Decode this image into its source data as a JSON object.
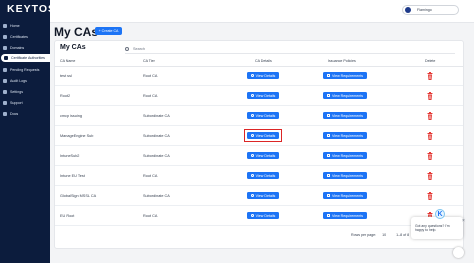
{
  "brand": {
    "logo_text": "KEYTOS"
  },
  "sidebar": {
    "items": [
      {
        "label": "Home",
        "icon": "home-icon"
      },
      {
        "label": "Certificates",
        "icon": "certificate-icon"
      },
      {
        "label": "Domains",
        "icon": "globe-icon"
      },
      {
        "label": "Certificate Authorities",
        "icon": "shield-icon"
      },
      {
        "label": "Pending Requests",
        "icon": "clock-icon"
      },
      {
        "label": "Audit Logs",
        "icon": "list-icon"
      },
      {
        "label": "Settings",
        "icon": "gear-icon"
      },
      {
        "label": "Support",
        "icon": "help-icon"
      },
      {
        "label": "Docs",
        "icon": "document-icon"
      }
    ]
  },
  "header": {
    "user_name": "Flamingo"
  },
  "page": {
    "title": "My CAs",
    "create_label": "+ Create CA",
    "card_title": "My CAs",
    "search_placeholder": "Search"
  },
  "table": {
    "columns": [
      "CA Name",
      "CA Tier",
      "CA Details",
      "Issuance Policies",
      "Delete"
    ],
    "details_label": "View Details",
    "policies_label": "View Requirements",
    "rows": [
      {
        "name": "test ssl",
        "tier": "Root CA"
      },
      {
        "name": "Root2",
        "tier": "Root CA"
      },
      {
        "name": "cmcp issuing",
        "tier": "Subordinate CA"
      },
      {
        "name": "ManageEngine Sub",
        "tier": "Subordinate CA"
      },
      {
        "name": "IntuneSub2",
        "tier": "Subordinate CA"
      },
      {
        "name": "Intune EU Test",
        "tier": "Root CA"
      },
      {
        "name": "GlobalSign MSSL CA",
        "tier": "Subordinate CA"
      },
      {
        "name": "EU Root",
        "tier": "Root CA"
      }
    ],
    "highlighted_row": 3
  },
  "pagination": {
    "rows_per_page_label": "Rows per page:",
    "rows_per_page_value": "10",
    "range": "1–8 of 8"
  },
  "chat": {
    "message": "Got any questions? I'm happy to help.",
    "avatar_letter": "K",
    "close": "×"
  },
  "colors": {
    "sidebar": "#0c1c3d",
    "accent": "#1d74f5",
    "delete": "#e53935",
    "highlight": "#dc2626"
  }
}
